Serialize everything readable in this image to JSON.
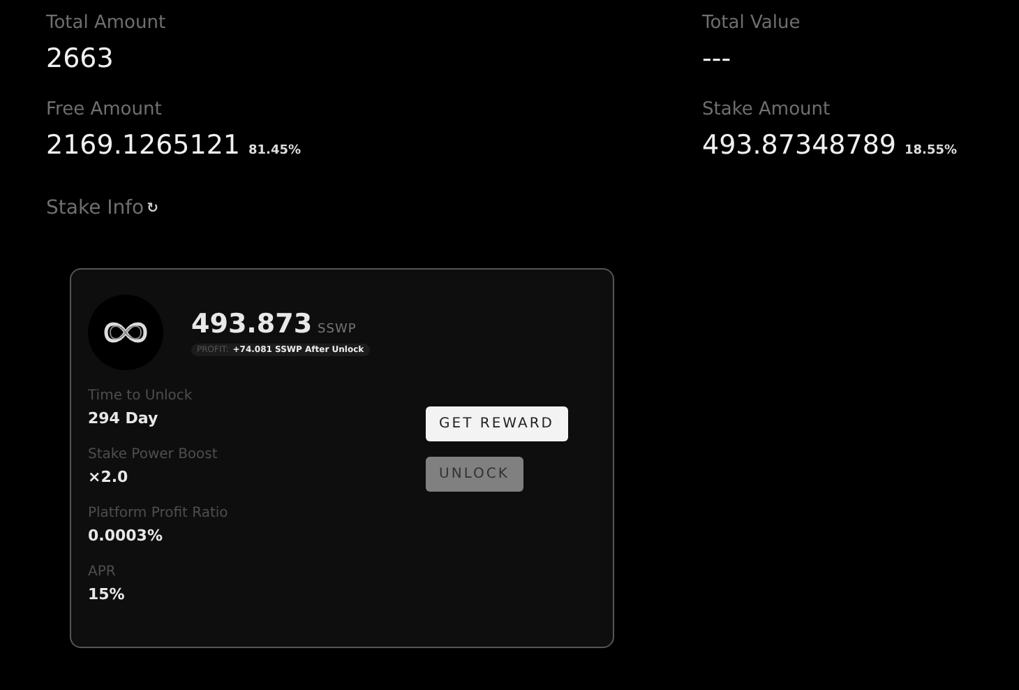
{
  "summary": [
    {
      "label": "Total Amount",
      "value": "2663"
    },
    {
      "label": "Total Value",
      "value": "---"
    },
    {
      "label": "Free Amount",
      "value": "2169.1265121",
      "percent": "81.45%"
    },
    {
      "label": "Stake Amount",
      "value": "493.87348789",
      "percent": "18.55%"
    }
  ],
  "stake_info": {
    "title": "Stake Info",
    "refresh_icon": "↻"
  },
  "stake_card": {
    "amount": "493.873",
    "unit": "SSWP",
    "profit_label": "PROFIT:",
    "profit_value": "+74.081 SSWP After Unlock",
    "details": [
      {
        "label": "Time to Unlock",
        "value": "294 Day"
      },
      {
        "label": "Stake Power Boost",
        "value": "×2.0"
      },
      {
        "label": "Platform Profit Ratio",
        "value": "0.0003%"
      },
      {
        "label": "APR",
        "value": "15%"
      }
    ],
    "buttons": [
      {
        "label": "GET REWARD",
        "disabled": false
      },
      {
        "label": "UNLOCK",
        "disabled": true
      }
    ]
  }
}
